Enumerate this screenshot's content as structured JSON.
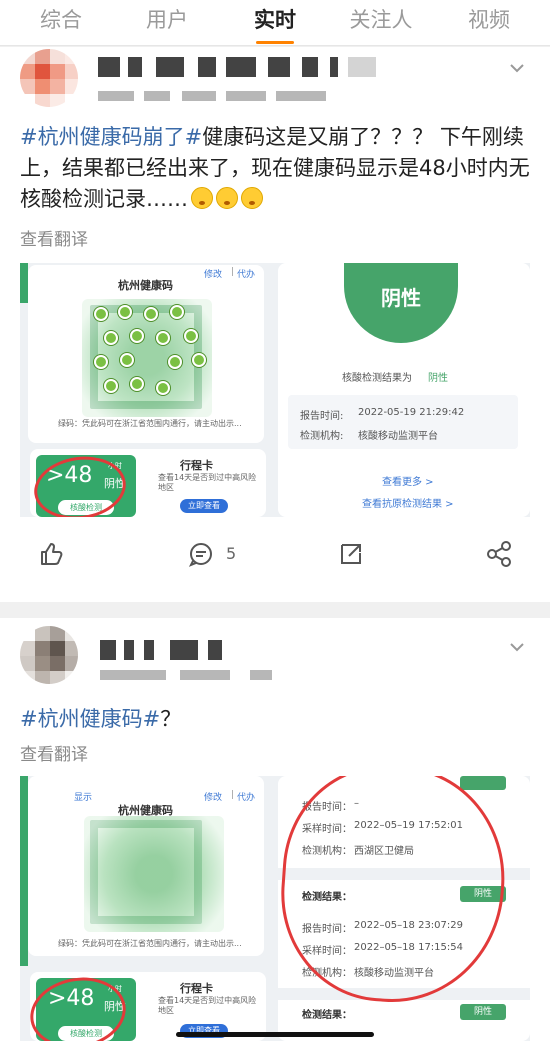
{
  "tabs": [
    {
      "label": "综合",
      "active": false
    },
    {
      "label": "用户",
      "active": false
    },
    {
      "label": "实时",
      "active": true
    },
    {
      "label": "关注人",
      "active": false
    },
    {
      "label": "视频",
      "active": false
    }
  ],
  "posts": [
    {
      "hashtag": "#杭州健康码崩了#",
      "text": "健康码这是又崩了？？？ 下午刚续上，结果都已经出来了，现在健康码显示是48小时内无核酸检测记录……",
      "translate": "查看翻译",
      "comments_count": "5",
      "screenshot": {
        "qr_title": "杭州健康码",
        "edit_link": "修改",
        "proxy_link": "代办",
        "green_note": "绿码：凭此码可在浙江省范围内通行，请主动出示...",
        "hours": ">48",
        "hours_unit": "小时",
        "negative_small": "阴性",
        "nucleic_button": "核酸检测",
        "itinerary_title": "行程卡",
        "itinerary_desc": "查看14天是否到过中高风险地区",
        "itinerary_button": "立即查看",
        "result_circle": "阴性",
        "result_label": "核酸检测结果为",
        "result_value": "阴性",
        "report_time_label": "报告时间:",
        "report_time": "2022-05-19 21:29:42",
        "agency_label": "检测机构:",
        "agency": "核酸移动监测平台",
        "more_link": "查看更多 >",
        "antigen_link": "查看抗原检测结果 >"
      }
    },
    {
      "hashtag": "#杭州健康码#",
      "text": "？",
      "translate": "查看翻译",
      "screenshot": {
        "qr_title": "杭州健康码",
        "edit_link": "修改",
        "proxy_link": "代办",
        "show_text": "显示",
        "green_note": "绿码：凭此码可在浙江省范围内通行，请主动出示...",
        "hours": ">48",
        "hours_unit": "小时",
        "negative_small": "阴性",
        "nucleic_button": "核酸检测",
        "itinerary_title": "行程卡",
        "itinerary_desc": "查看14天是否到过中高风险地区",
        "itinerary_button": "立即查看",
        "rows": [
          {
            "label": "报告时间：",
            "value": "–"
          },
          {
            "label": "采样时间：",
            "value": "2022–05–19 17:52:01"
          },
          {
            "label": "检测机构：",
            "value": "西湖区卫健局"
          }
        ],
        "result2_label": "检测结果：",
        "result2_badge": "阴性",
        "rows2": [
          {
            "label": "报告时间：",
            "value": "2022–05–18 23:07:29"
          },
          {
            "label": "采样时间：",
            "value": "2022–05–18 17:15:54"
          },
          {
            "label": "检测机构：",
            "value": "核酸移动监测平台"
          }
        ],
        "result3_label": "检测结果：",
        "result3_badge": "阴性"
      }
    }
  ]
}
